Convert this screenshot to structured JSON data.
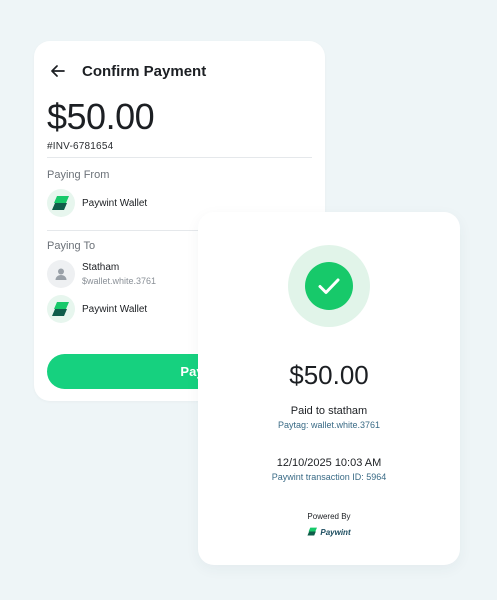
{
  "confirm": {
    "title": "Confirm Payment",
    "amount": "$50.00",
    "invoice": "#INV-6781654",
    "paying_from_label": "Paying From",
    "from_account": {
      "name": "Paywint Wallet",
      "icon": "paywint-logo-icon"
    },
    "paying_to_label": "Paying To",
    "to_recipient": {
      "name": "Statham",
      "tag": "$wallet.white.3761",
      "icon": "user-icon"
    },
    "to_account": {
      "name": "Paywint Wallet",
      "icon": "paywint-logo-icon"
    },
    "pay_label": "Pay"
  },
  "receipt": {
    "amount": "$50.00",
    "paid_to": "Paid to statham",
    "paytag": "Paytag: wallet.white.3761",
    "datetime": "12/10/2025 10:03 AM",
    "transaction": "Paywint transaction ID: 5964",
    "powered_by": "Powered By",
    "brand": "Paywint"
  },
  "colors": {
    "background": "#eef5f7",
    "accent": "#16d17f",
    "success": "#17c96a",
    "success_ring": "#e1f4e9",
    "link_text": "#3a6b86",
    "brand_dark": "#1a4b5e"
  }
}
